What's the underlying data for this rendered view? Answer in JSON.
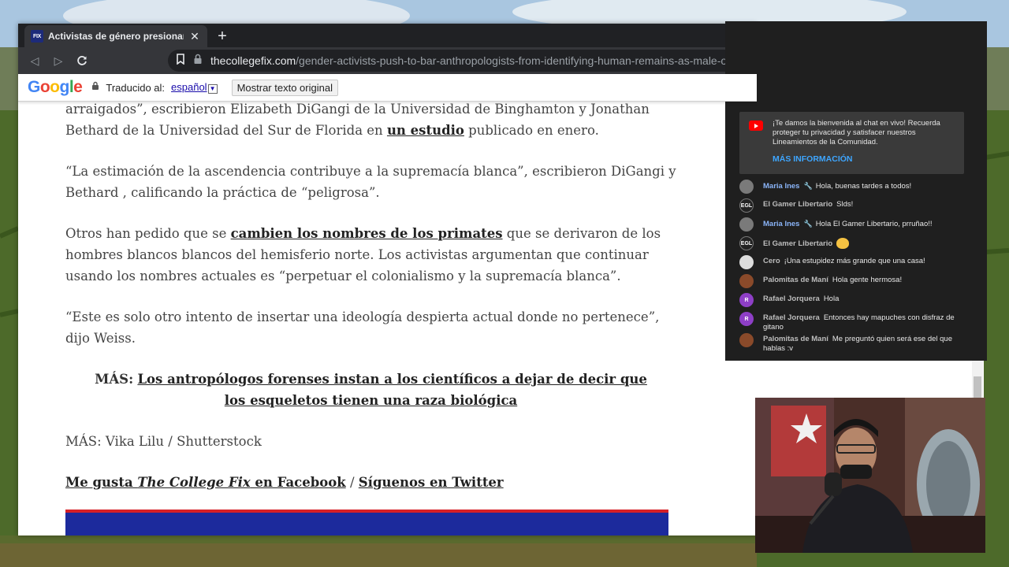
{
  "browser": {
    "tab_title": "Activistas de género presionan para",
    "tab_favicon": "FIX",
    "url_host": "thecollegefix.com",
    "url_path": "/gender-activists-push-to-bar-anthropologists-from-identifying-human-remains-as-male-o"
  },
  "translate_bar": {
    "label": "Traducido al:",
    "language": "español",
    "button": "Mostrar texto original"
  },
  "article": {
    "p1": "arraigados”, escribieron Elizabeth DiGangi de la Universidad de Binghamton y Jonathan Bethard de la Universidad del Sur de Florida en ",
    "p1_link": "un estudio",
    "p1_end": " publicado en enero.",
    "p2": "“La estimación de la ascendencia contribuye a la supremacía blanca”, escribieron DiGangi y Bethard , calificando la práctica de “peligrosa”.",
    "p3_start": "Otros han pedido que se ",
    "p3_link": "cambien los nombres de los primates",
    "p3_end": " que se derivaron de los hombres blancos blancos del hemisferio norte. Los activistas argumentan que continuar usando los nombres actuales es “perpetuar el colonialismo y la supremacía blanca”.",
    "p4": "“Este es solo otro intento de insertar una ideología despierta actual donde no pertenece”, dijo Weiss.",
    "more_label": "MÁS:",
    "more_link": "Los antropólogos forenses instan a los científicos a dejar de decir que los esqueletos tienen una raza biológica",
    "credit": "MÁS: Vika Lilu / Shutterstock",
    "social_like_pre": "Me gusta ",
    "social_like_italic": "The College Fix",
    "social_like_post": " en Facebook",
    "social_sep": " / ",
    "social_follow": "Síguenos en Twitter"
  },
  "chat": {
    "welcome_text": "¡Te damos la bienvenida al chat en vivo! Recuerda proteger tu privacidad y satisfacer nuestros Lineamientos de la Comunidad.",
    "welcome_link": "MÁS INFORMACIÓN",
    "messages": [
      {
        "author": "Maria Ines",
        "text": "Hola, buenas tardes a todos!",
        "avatar": "",
        "avatar_color": "#7a7a7a",
        "member": true
      },
      {
        "author": "El Gamer Libertario",
        "text": "Slds!",
        "avatar": "EGL",
        "avatar_color": "#222222",
        "member": false
      },
      {
        "author": "Maria Ines",
        "text": "Hola El Gamer Libertario, prruñao!!",
        "avatar": "",
        "avatar_color": "#7a7a7a",
        "member": true
      },
      {
        "author": "El Gamer Libertario",
        "text": "",
        "avatar": "EGL",
        "avatar_color": "#222222",
        "member": false
      },
      {
        "author": "Cero",
        "text": "¡Una estupidez más grande que una casa!",
        "avatar": "",
        "avatar_color": "#dddddd",
        "member": false
      },
      {
        "author": "Palomitas de Maní",
        "text": "Hola gente hermosa!",
        "avatar": "",
        "avatar_color": "#8a4a2a",
        "member": false
      },
      {
        "author": "Rafael Jorquera",
        "text": "Hola",
        "avatar": "R",
        "avatar_color": "#8e3fc7",
        "member": false
      },
      {
        "author": "Rafael Jorquera",
        "text": "Entonces hay mapuches con disfraz de gitano",
        "avatar": "R",
        "avatar_color": "#8e3fc7",
        "member": false
      },
      {
        "author": "Palomitas de Maní",
        "text": "Me preguntó quien será ese del que hablas :v",
        "avatar": "",
        "avatar_color": "#8a4a2a",
        "member": false
      }
    ]
  }
}
